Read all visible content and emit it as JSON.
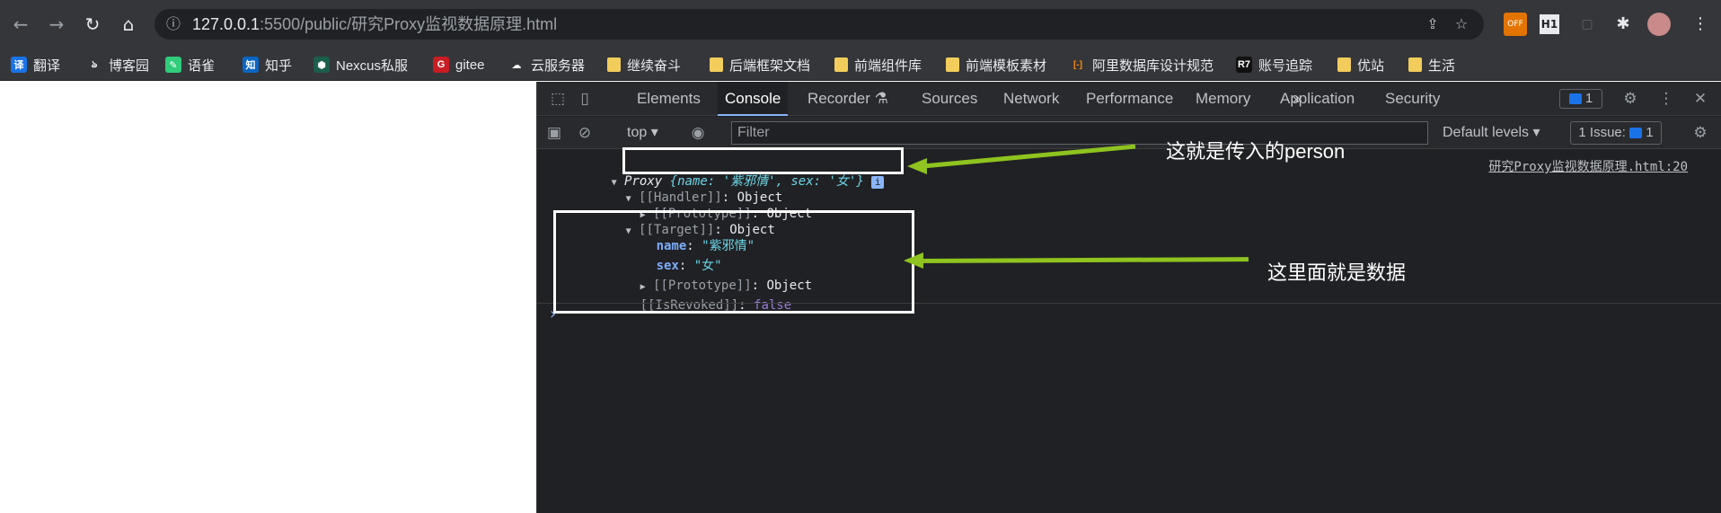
{
  "browser": {
    "url_host": "127.0.0.1",
    "url_rest": ":5500/public/研究Proxy监视数据原理.html"
  },
  "bookmarks": [
    {
      "label": "翻译",
      "icon": "translate-icon",
      "color": "#1a73e8",
      "glyph": "译"
    },
    {
      "label": "博客园",
      "icon": "cnblogs-icon",
      "color": "#35363a",
      "glyph": "ঌ"
    },
    {
      "label": "语雀",
      "icon": "yuque-icon",
      "color": "#31cc79",
      "glyph": "✎"
    },
    {
      "label": "知乎",
      "icon": "zhihu-icon",
      "color": "#0a66c2",
      "glyph": "知"
    },
    {
      "label": "Nexcus私服",
      "icon": "nexus-icon",
      "color": "#1b5e4b",
      "glyph": "⬢"
    },
    {
      "label": "gitee",
      "icon": "gitee-icon",
      "color": "#c71d23",
      "glyph": "G"
    },
    {
      "label": "云服务器",
      "icon": "cloud-icon",
      "color": "#35363a",
      "glyph": "☁"
    },
    {
      "label": "继续奋斗",
      "icon": "folder-icon"
    },
    {
      "label": "后端框架文档",
      "icon": "folder-icon"
    },
    {
      "label": "前端组件库",
      "icon": "folder-icon"
    },
    {
      "label": "前端模板素材",
      "icon": "folder-icon"
    },
    {
      "label": "阿里数据库设计规范",
      "icon": "aliyun-icon",
      "color": "#35363a",
      "glyph": "[-]"
    },
    {
      "label": "账号追踪",
      "icon": "r7-icon",
      "color": "#111111",
      "glyph": "R7"
    },
    {
      "label": "优站",
      "icon": "folder-icon"
    },
    {
      "label": "生活",
      "icon": "folder-icon"
    }
  ],
  "devtools": {
    "tabs": [
      "Elements",
      "Console",
      "Recorder ⚗",
      "Sources",
      "Network",
      "Performance",
      "Memory",
      "Application",
      "Security"
    ],
    "active_tab": "Console",
    "more": "»",
    "message_count": "1",
    "context": "top",
    "filter_placeholder": "Filter",
    "levels": "Default levels",
    "issues": "1 Issue:",
    "issues_count": "1"
  },
  "console": {
    "source_link": "研究Proxy监视数据原理.html:20",
    "proxy_label": "Proxy",
    "proxy_preview": "{name: '紫邪情', sex: '女'}",
    "handler": "[[Handler]]",
    "object": "Object",
    "prototype": "[[Prototype]]",
    "target": "[[Target]]",
    "name_key": "name",
    "name_value": "\"紫邪情\"",
    "sex_key": "sex",
    "sex_value": "\"女\"",
    "revoked": "[[IsRevoked]]",
    "revoked_value": "false",
    "prompt": "›"
  },
  "annotations": {
    "person": "这就是传入的person",
    "data": "这里面就是数据"
  },
  "colors": {
    "arrow": "#8fc31f",
    "key": "#7cacf8",
    "string": "#6bd4e5"
  }
}
